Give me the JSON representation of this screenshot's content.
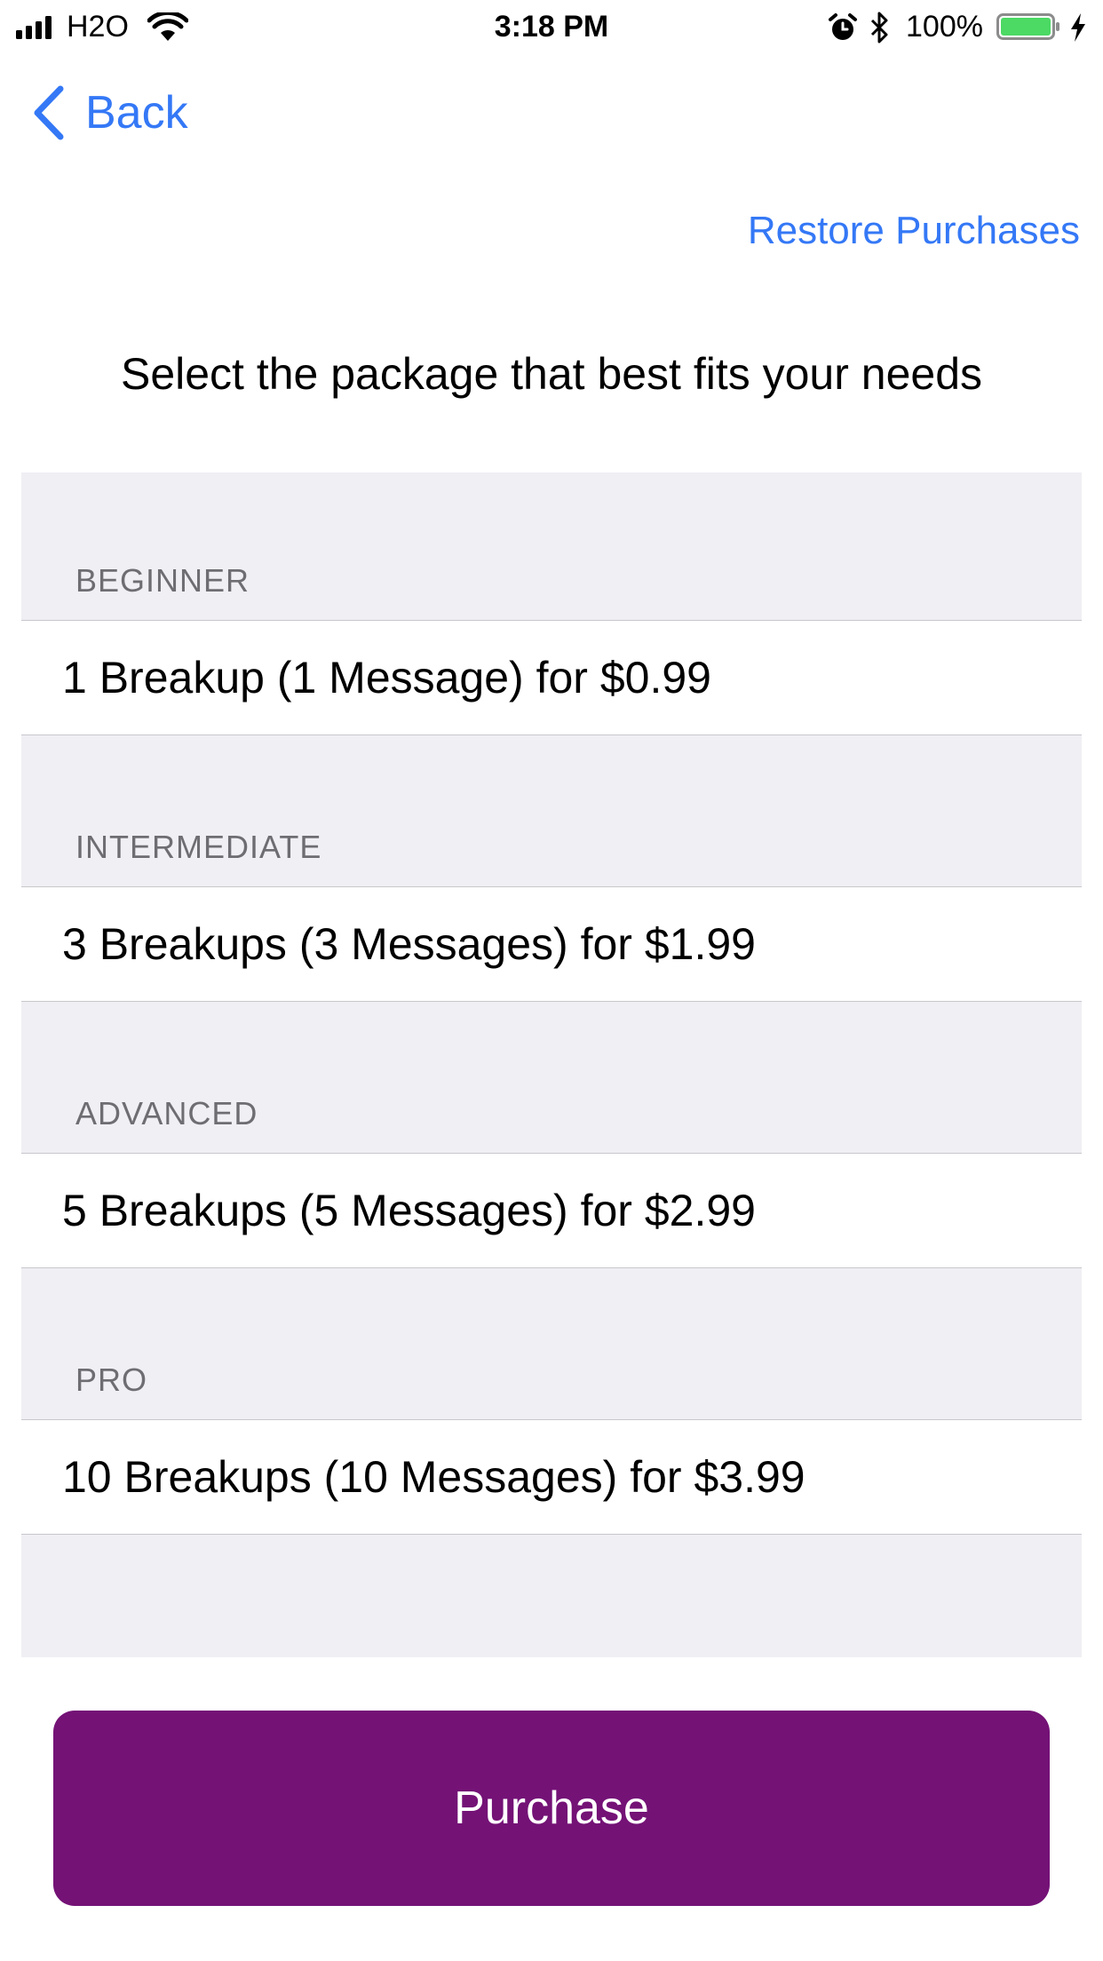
{
  "status_bar": {
    "carrier": "H2O",
    "time": "3:18 PM",
    "battery_percent": "100%",
    "battery_level": 1.0,
    "battery_color": "#4cd964",
    "icons": [
      "signal-icon",
      "wifi-icon",
      "alarm-icon",
      "bluetooth-icon",
      "battery-icon",
      "charging-bolt-icon"
    ]
  },
  "nav": {
    "back_label": "Back",
    "restore_label": "Restore Purchases",
    "accent_color": "#3478f6"
  },
  "headline": "Select the package that best fits your needs",
  "packages": [
    {
      "section": "BEGINNER",
      "label": "1 Breakup (1 Message) for $0.99"
    },
    {
      "section": "INTERMEDIATE",
      "label": "3 Breakups (3 Messages) for $1.99"
    },
    {
      "section": "ADVANCED",
      "label": "5 Breakups (5 Messages) for $2.99"
    },
    {
      "section": "PRO",
      "label": "10 Breakups (10 Messages) for $3.99"
    }
  ],
  "purchase_button": {
    "label": "Purchase",
    "color": "#741276"
  }
}
